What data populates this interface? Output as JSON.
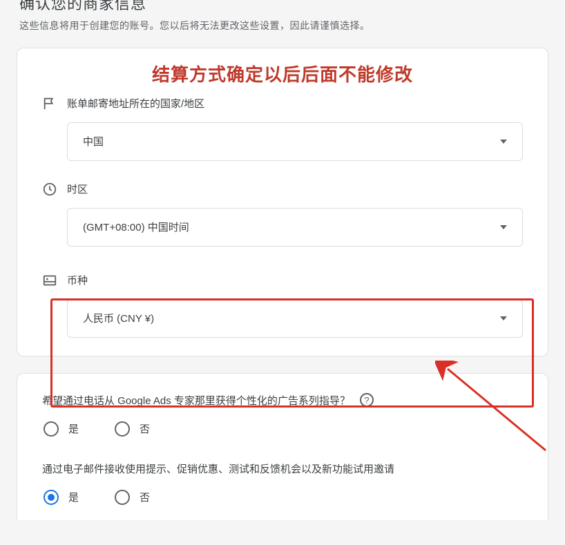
{
  "header": {
    "title_partial": "确认您的商家信息",
    "subtitle": "这些信息将用于创建您的账号。您以后将无法更改这些设置，因此请谨慎选择。"
  },
  "annotation": "结算方式确定以后后面不能修改",
  "fields": {
    "country": {
      "label": "账单邮寄地址所在的国家/地区",
      "value": "中国"
    },
    "timezone": {
      "label": "时区",
      "value": "(GMT+08:00) 中国时间"
    },
    "currency": {
      "label": "币种",
      "value": "人民币 (CNY ¥)"
    }
  },
  "questions": {
    "phone": {
      "text": "希望通过电话从 Google Ads 专家那里获得个性化的广告系列指导？",
      "options": {
        "yes": "是",
        "no": "否"
      },
      "selected": null
    },
    "email": {
      "text": "通过电子邮件接收使用提示、促销优惠、测试和反馈机会以及新功能试用邀请",
      "options": {
        "yes": "是",
        "no": "否"
      },
      "selected": "yes"
    }
  }
}
